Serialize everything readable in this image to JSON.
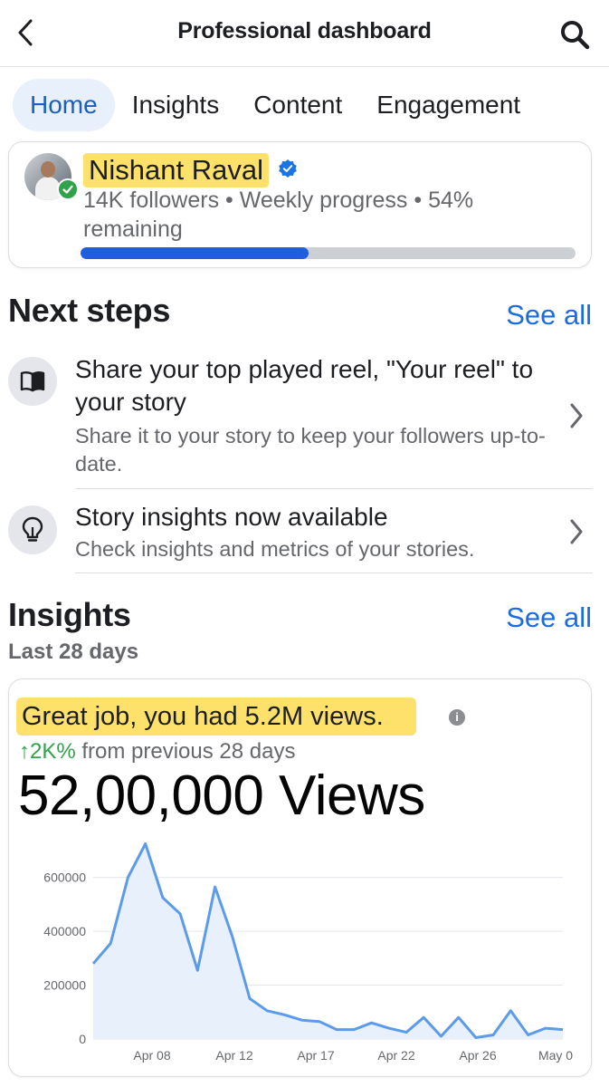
{
  "header": {
    "title": "Professional dashboard",
    "back_icon": "chevron-left-icon",
    "search_icon": "search-icon"
  },
  "tabs": [
    {
      "label": "Home",
      "active": true
    },
    {
      "label": "Insights",
      "active": false
    },
    {
      "label": "Content",
      "active": false
    },
    {
      "label": "Engagement",
      "active": false
    }
  ],
  "profile": {
    "name": "Nishant Raval",
    "verified": true,
    "subtitle": "14K followers • Weekly progress • 54% remaining",
    "progress_fraction": 0.46,
    "colors": {
      "highlight": "#fde16b",
      "progress": "#1f5ee0",
      "track": "#ccd0d5"
    }
  },
  "next_steps": {
    "title": "Next steps",
    "see_all": "See all",
    "items": [
      {
        "icon": "book-icon",
        "title": "Share your top played reel, \"Your reel\" to your story",
        "description": "Share it to your story to keep your followers up-to-date."
      },
      {
        "icon": "lightbulb-icon",
        "title": "Story insights now available",
        "description": "Check insights and metrics of your stories."
      }
    ]
  },
  "insights": {
    "title": "Insights",
    "see_all": "See all",
    "period": "Last 28 days",
    "headline": "Great job, you had 5.2M views.",
    "change_arrow": "↑2K%",
    "change_text": " from previous 28 days",
    "total": "52,00,000 Views"
  },
  "chart_data": {
    "type": "area",
    "title": "",
    "xlabel": "",
    "ylabel": "",
    "x_tick_labels": [
      "Apr 08",
      "Apr 12",
      "Apr 17",
      "Apr 22",
      "Apr 26",
      "May 0"
    ],
    "y_tick_labels": [
      "0",
      "200000",
      "400000",
      "600000"
    ],
    "ylim": [
      0,
      720000
    ],
    "grid": true,
    "line_color": "#5b9bea",
    "fill_color": "#e8f0fc",
    "series": [
      {
        "values": [
          280000,
          355000,
          600000,
          725000,
          525000,
          465000,
          255000,
          565000,
          380000,
          150000,
          105000,
          90000,
          70000,
          65000,
          35000,
          35000,
          60000,
          40000,
          25000,
          80000,
          10000,
          80000,
          5000,
          15000,
          105000,
          15000,
          40000,
          35000
        ]
      }
    ]
  }
}
